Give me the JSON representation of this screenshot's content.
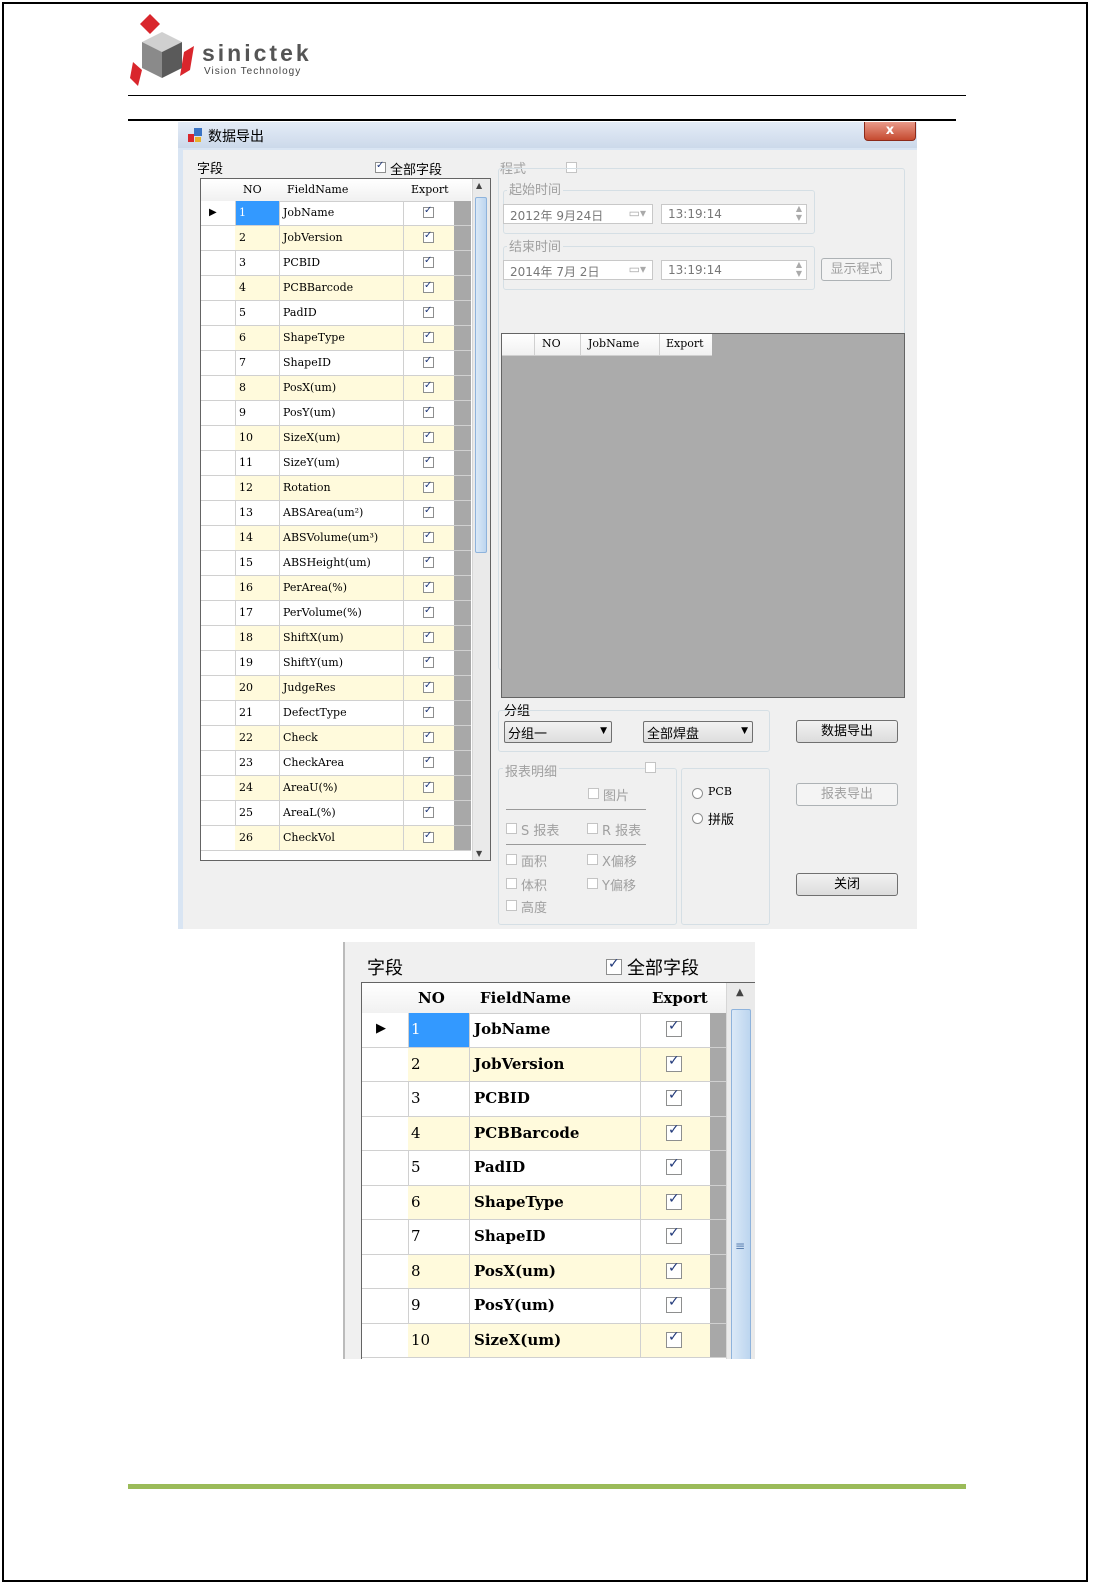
{
  "logo": {
    "brand": "sinictek",
    "tagline": "Vision Technology"
  },
  "dialog": {
    "title": "数据导出",
    "close_symbol": "x",
    "fields_group_label": "字段",
    "all_fields_label": "全部字段",
    "all_fields_checked": true,
    "grid_headers": {
      "no": "NO",
      "fieldname": "FieldName",
      "export": "Export"
    },
    "row_indicator": "▶",
    "rows": [
      {
        "no": "1",
        "name": "JobName"
      },
      {
        "no": "2",
        "name": "JobVersion"
      },
      {
        "no": "3",
        "name": "PCBID"
      },
      {
        "no": "4",
        "name": "PCBBarcode"
      },
      {
        "no": "5",
        "name": "PadID"
      },
      {
        "no": "6",
        "name": "ShapeType"
      },
      {
        "no": "7",
        "name": "ShapeID"
      },
      {
        "no": "8",
        "name": "PosX(um)"
      },
      {
        "no": "9",
        "name": "PosY(um)"
      },
      {
        "no": "10",
        "name": "SizeX(um)"
      },
      {
        "no": "11",
        "name": "SizeY(um)"
      },
      {
        "no": "12",
        "name": "Rotation"
      },
      {
        "no": "13",
        "name": "ABSArea(um²)"
      },
      {
        "no": "14",
        "name": "ABSVolume(um³)"
      },
      {
        "no": "15",
        "name": "ABSHeight(um)"
      },
      {
        "no": "16",
        "name": "PerArea(%)"
      },
      {
        "no": "17",
        "name": "PerVolume(%)"
      },
      {
        "no": "18",
        "name": "ShiftX(um)"
      },
      {
        "no": "19",
        "name": "ShiftY(um)"
      },
      {
        "no": "20",
        "name": "JudgeRes"
      },
      {
        "no": "21",
        "name": "DefectType"
      },
      {
        "no": "22",
        "name": "Check"
      },
      {
        "no": "23",
        "name": "CheckArea"
      },
      {
        "no": "24",
        "name": "AreaU(%)"
      },
      {
        "no": "25",
        "name": "AreaL(%)"
      },
      {
        "no": "26",
        "name": "CheckVol"
      }
    ],
    "program_label": "程式",
    "start_time_label": "起始时间",
    "start_date": "2012年 9月24日",
    "start_time": "13:19:14",
    "end_time_label": "结束时间",
    "end_date": "2014年 7月 2日",
    "end_time": "13:19:14",
    "show_program_button": "显示程式",
    "program_grid_headers": {
      "no": "NO",
      "jobname": "JobName",
      "export": "Export"
    },
    "group_label": "分组",
    "group_select": "分组一",
    "pad_select": "全部焊盘",
    "export_data_button": "数据导出",
    "report_detail_label": "报表明细",
    "picture_label": "图片",
    "s_report_label": "S 报表",
    "r_report_label": "R 报表",
    "area_label": "面积",
    "x_shift_label": "X偏移",
    "volume_label": "体积",
    "y_shift_label": "Y偏移",
    "height_label": "高度",
    "pcb_radio_label": "PCB",
    "panel_radio_label": "拼版",
    "report_export_button": "报表导出",
    "close_button": "关闭"
  },
  "zoom_rows_count": 10
}
